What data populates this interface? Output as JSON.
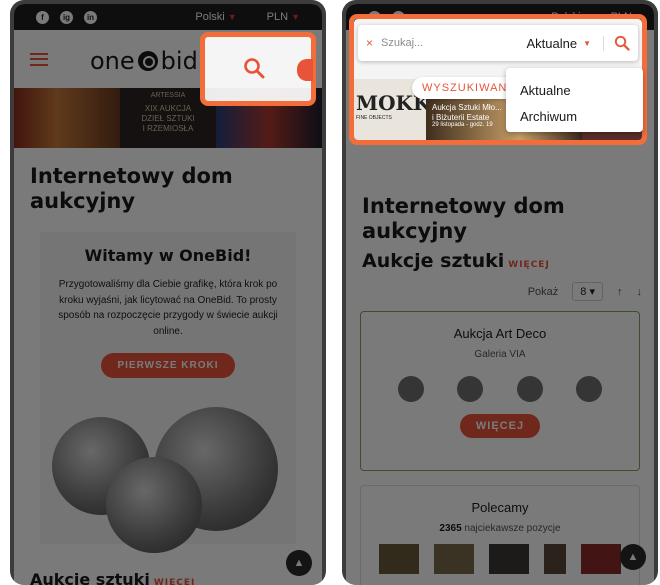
{
  "top_bar": {
    "social": [
      "f",
      "ig",
      "in"
    ],
    "language": "Polski",
    "currency": "PLN",
    "language_right": "Polski",
    "currency_right": "PLN"
  },
  "header": {
    "logo_left": "one",
    "logo_right": "bid"
  },
  "banner": {
    "line1": "ARTESSIA",
    "line2": "XIX AUKCJA",
    "line3": "DZIEŁ SZTUKI",
    "line4": "I RZEMIOSŁA"
  },
  "main": {
    "title": "Internetowy dom aukcyjny",
    "welcome_title": "Witamy w OneBid!",
    "welcome_text": "Przygotowaliśmy dla Ciebie grafikę, która krok po kroku wyjaśni, jak licytować na OneBid. To prosty sposób na rozpoczęcie przygody w świecie aukcji online.",
    "first_steps": "PIERWSZE KROKI",
    "section_title": "Aukcje sztuki",
    "more": "WIĘCEJ"
  },
  "search": {
    "placeholder": "Szukaj...",
    "scope": "Aktualne",
    "options": [
      "Aktualne",
      "Archiwum"
    ],
    "search_button": "WYSZUKIWANIE",
    "clear": "×"
  },
  "right_banner": {
    "brand": "MOKK",
    "sub": "FINE OBJECTS",
    "auction": "Aukcja Sztuki Mło...",
    "auction2": "i Biżuterii Estate",
    "date": "29 listopada - godz. 19"
  },
  "pager": {
    "label": "Pokaż",
    "per_page": "8 ▾",
    "up": "↑",
    "down": "↓"
  },
  "card1": {
    "title": "Aukcja Art Deco",
    "subtitle": "Galeria VIA",
    "button": "WIĘCEJ"
  },
  "card2": {
    "title": "Polecamy",
    "count": "2365",
    "count_text": "najciekawsze pozycje"
  },
  "colors": {
    "accent": "#e8543a",
    "highlight": "#f36d3a"
  }
}
